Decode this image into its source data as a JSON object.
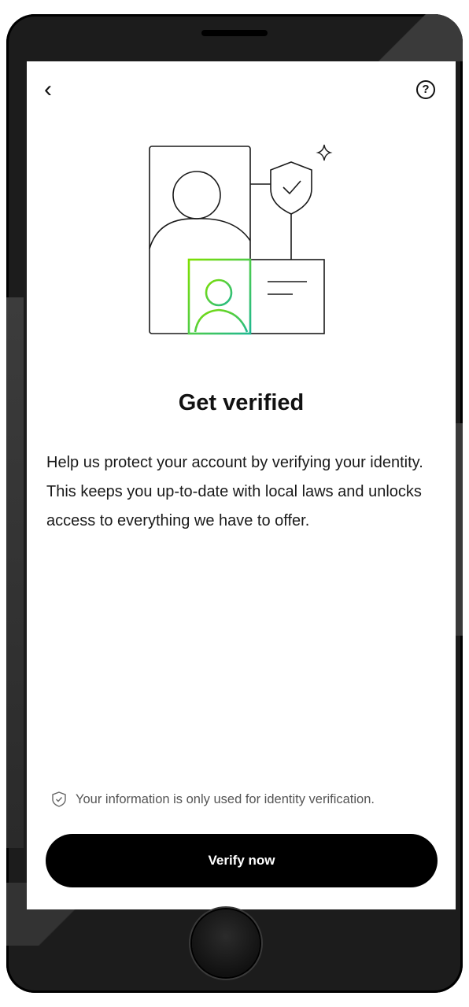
{
  "header": {
    "back_icon": "chevron-left-icon",
    "back_glyph": "‹",
    "help_icon": "question-circle-icon",
    "help_glyph": "?"
  },
  "illustration": {
    "icon": "identity-verification-illustration",
    "accent_green": "#3ddc35",
    "accent_teal": "#2bb8a0"
  },
  "content": {
    "title": "Get verified",
    "description": "Help us protect your account by verifying your identity. This keeps you up-to-date with local laws and unlocks access to everything we have to offer."
  },
  "footer": {
    "privacy_icon": "shield-check-icon",
    "privacy_text": "Your information is only used for identity verification.",
    "verify_label": "Verify now"
  },
  "colors": {
    "button_bg": "#000000",
    "button_text": "#ffffff",
    "text_primary": "#111111",
    "text_secondary": "#555555"
  }
}
